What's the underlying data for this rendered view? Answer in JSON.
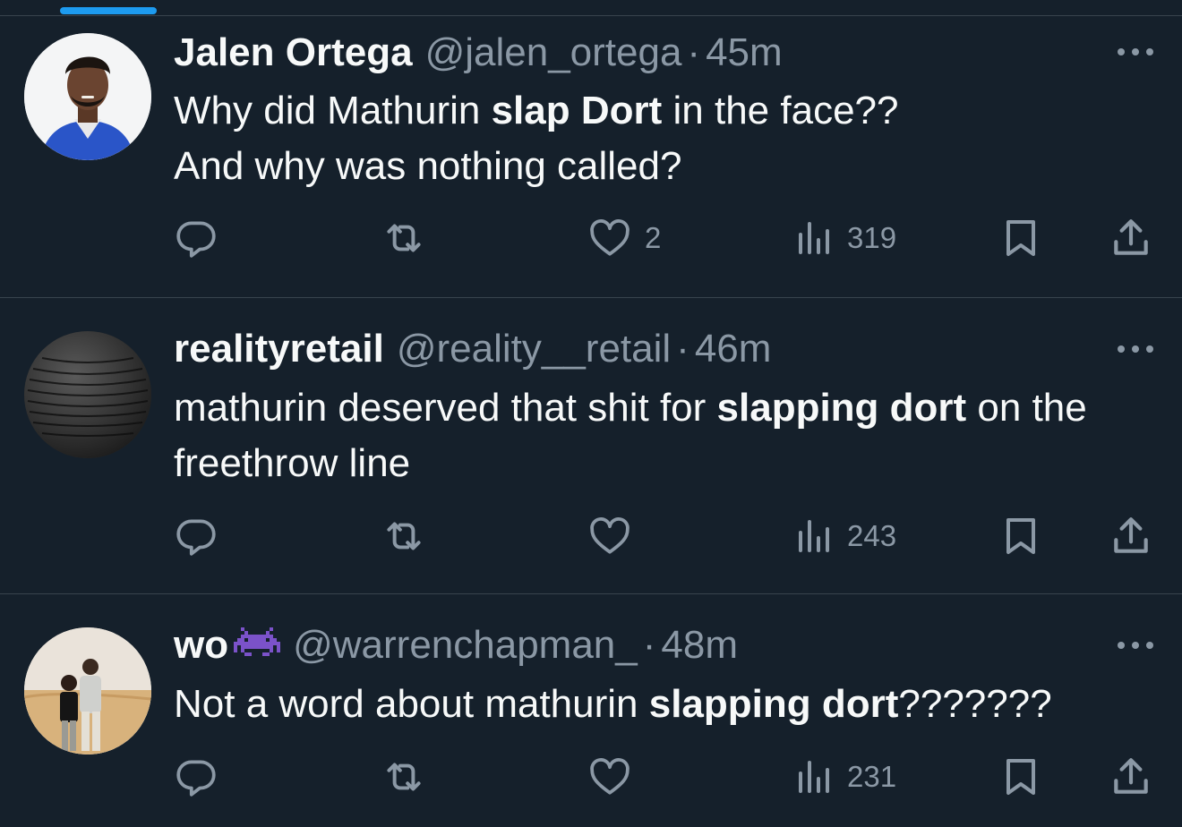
{
  "colors": {
    "background": "#15202b",
    "divider": "#38444d",
    "text_primary": "#f7f9f9",
    "text_secondary": "#8b98a5",
    "accent": "#1d9bf0"
  },
  "tweets": [
    {
      "name": "Jalen Ortega",
      "handle": "@jalen_ortega",
      "separator": "·",
      "time": "45m",
      "text_parts": [
        "Why did Mathurin ",
        "slap Dort",
        " in the face??",
        "And why was nothing called?"
      ],
      "replies": "",
      "retweets": "",
      "likes": "2",
      "views": "319"
    },
    {
      "name": "realityretail",
      "handle": "@reality__retail",
      "separator": "·",
      "time": "46m",
      "text_parts": [
        "mathurin deserved that shit for ",
        "slapping dort",
        " on the freethrow line"
      ],
      "replies": "",
      "retweets": "",
      "likes": "",
      "views": "243"
    },
    {
      "name": "wo",
      "name_emoji": "alien-monster-icon",
      "handle": "@warrenchapman_",
      "separator": "·",
      "time": "48m",
      "text_parts": [
        "Not a word about mathurin ",
        "slapping dort",
        "???????"
      ],
      "replies": "",
      "retweets": "",
      "likes": "",
      "views": "231"
    }
  ],
  "icons": {
    "reply": "reply-icon",
    "retweet": "retweet-icon",
    "like": "heart-icon",
    "views": "views-icon",
    "bookmark": "bookmark-icon",
    "share": "share-icon",
    "more": "more-icon"
  }
}
